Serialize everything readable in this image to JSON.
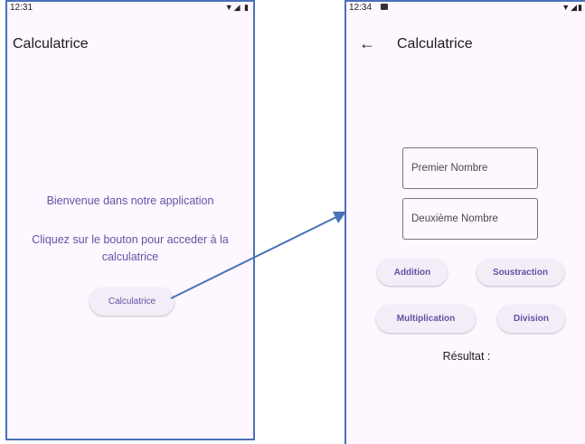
{
  "screen1": {
    "status_time": "12:31",
    "status_icons": "▼◢ ▮",
    "title": "Calculatrice",
    "welcome_text": "Bienvenue dans notre application",
    "instruction_text": "Cliquez sur le bouton pour acceder à la calculatrice",
    "button_label": "Calculatrice"
  },
  "screen2": {
    "status_time": "12:34",
    "status_icons": "▼◢▮",
    "back_icon": "←",
    "title": "Calculatrice",
    "first_number_placeholder": "Premier Nombre",
    "second_number_placeholder": "Deuxième Nombre",
    "buttons": {
      "addition": "Addition",
      "subtraction": "Soustraction",
      "multiplication": "Multiplication",
      "division": "Division"
    },
    "result_label": "Résultat :"
  },
  "colors": {
    "accent": "#6750a4",
    "frame": "#4a72b8",
    "background": "#fef7ff",
    "button_bg": "#f3edf7"
  }
}
